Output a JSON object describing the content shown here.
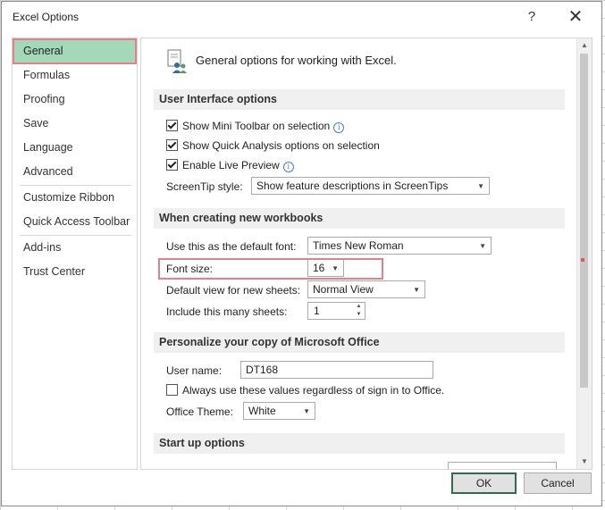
{
  "window": {
    "title": "Excel Options",
    "help": "?",
    "close": "✕"
  },
  "nav": {
    "items": [
      {
        "label": "General"
      },
      {
        "label": "Formulas"
      },
      {
        "label": "Proofing"
      },
      {
        "label": "Save"
      },
      {
        "label": "Language"
      },
      {
        "label": "Advanced"
      },
      {
        "label": "Customize Ribbon"
      },
      {
        "label": "Quick Access Toolbar"
      },
      {
        "label": "Add-ins"
      },
      {
        "label": "Trust Center"
      }
    ],
    "selected": "General"
  },
  "main": {
    "header": "General options for working with Excel.",
    "ui_section": {
      "title": "User Interface options",
      "mini_toolbar": {
        "label": "Show Mini Toolbar on selection",
        "checked": true
      },
      "quick_analysis": {
        "label": "Show Quick Analysis options on selection",
        "checked": true
      },
      "live_preview": {
        "label": "Enable Live Preview",
        "checked": true
      },
      "screentip": {
        "label": "ScreenTip style:",
        "value": "Show feature descriptions in ScreenTips"
      }
    },
    "new_wb_section": {
      "title": "When creating new workbooks",
      "default_font": {
        "label": "Use this as the default font:",
        "value": "Times New Roman"
      },
      "font_size": {
        "label": "Font size:",
        "value": "16"
      },
      "default_view": {
        "label": "Default view for new sheets:",
        "value": "Normal View"
      },
      "sheets": {
        "label": "Include this many sheets:",
        "value": "1"
      }
    },
    "personalize_section": {
      "title": "Personalize your copy of Microsoft Office",
      "user_name": {
        "label": "User name:",
        "value": "DT168"
      },
      "always_use": {
        "label": "Always use these values regardless of sign in to Office.",
        "checked": false
      },
      "theme": {
        "label": "Office Theme:",
        "value": "White"
      }
    },
    "startup_section": {
      "title": "Start up options"
    }
  },
  "buttons": {
    "ok": "OK",
    "cancel": "Cancel"
  },
  "colors": {
    "selected_nav": "#a3d9b8",
    "highlight_box": "#e87e87",
    "ok_border": "#2a6f4a"
  }
}
